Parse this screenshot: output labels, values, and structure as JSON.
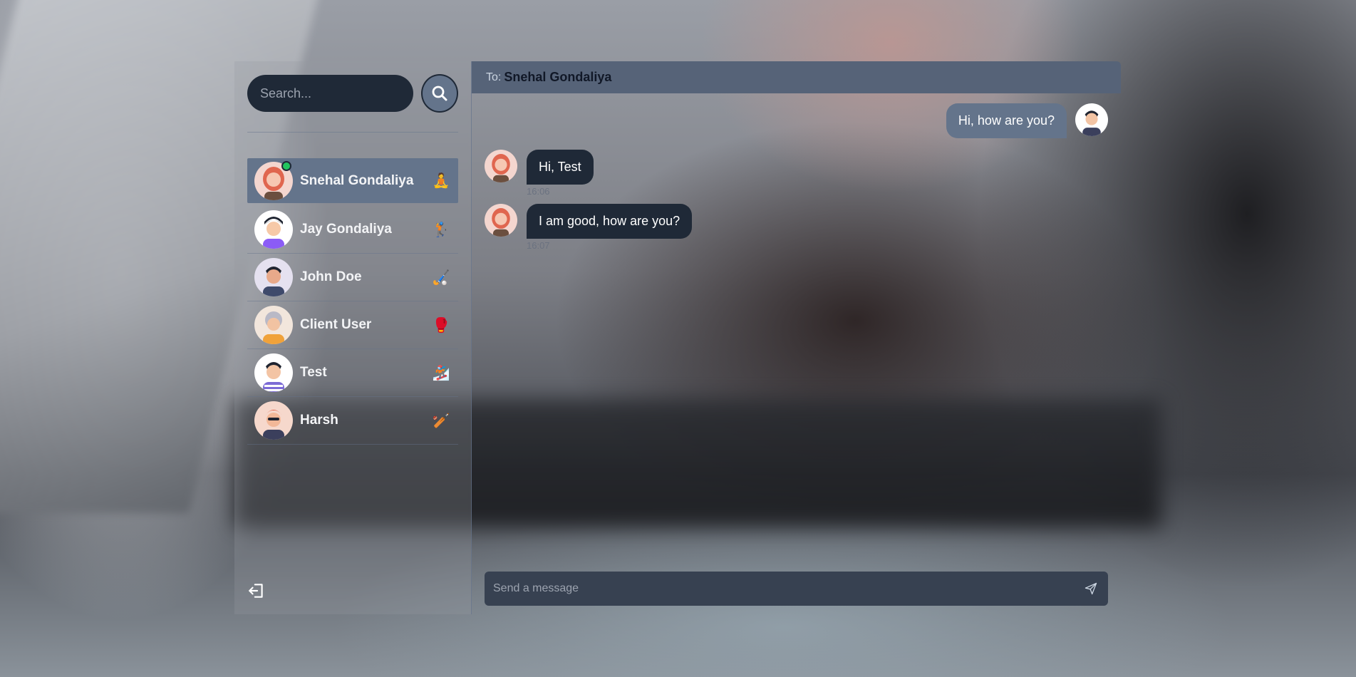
{
  "search": {
    "placeholder": "Search..."
  },
  "contacts": [
    {
      "name": "Snehal Gondaliya",
      "emoji": "🧘",
      "active": true,
      "online": true
    },
    {
      "name": "Jay Gondaliya",
      "emoji": "🏌",
      "active": false
    },
    {
      "name": "John Doe",
      "emoji": "🏑",
      "active": false
    },
    {
      "name": "Client User",
      "emoji": "🥊",
      "active": false
    },
    {
      "name": "Test",
      "emoji": "🏂",
      "active": false
    },
    {
      "name": "Harsh",
      "emoji": "🏏",
      "active": false
    }
  ],
  "header": {
    "to_label": "To:",
    "recipient": "Snehal Gondaliya"
  },
  "messages": [
    {
      "from": "me",
      "text": "Hi, how are you?",
      "time": ""
    },
    {
      "from": "them",
      "text": "Hi, Test",
      "time": "16:06"
    },
    {
      "from": "them",
      "text": "I am good, how are you?",
      "time": "16:07"
    }
  ],
  "composer": {
    "placeholder": "Send a message"
  },
  "icons": {
    "search": "search-icon",
    "send": "send-icon",
    "logout": "logout-icon"
  },
  "colors": {
    "active_contact": "#64748b",
    "header": "#566378",
    "my_bubble": "#64748b",
    "their_bubble": "#1f2937",
    "online": "#22c55e"
  }
}
